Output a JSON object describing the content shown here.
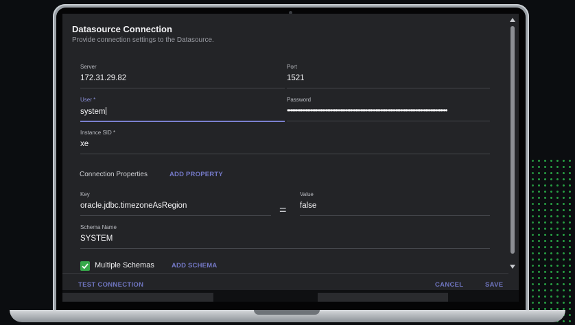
{
  "dialog": {
    "title": "Datasource Connection",
    "subtitle": "Provide connection settings to the Datasource."
  },
  "fields": {
    "server": {
      "label": "Server",
      "value": "172.31.29.82"
    },
    "port": {
      "label": "Port",
      "value": "1521"
    },
    "user": {
      "label": "User *",
      "value": "system"
    },
    "password": {
      "label": "Password",
      "value": "••••••••••••••••••••••••••••••••••••••••••••••••••••••••••••••••••••••••••••••••••••••••••••••••"
    },
    "instance_sid": {
      "label": "Instance SID *",
      "value": "xe"
    }
  },
  "connection_properties": {
    "label": "Connection Properties",
    "add_button": "ADD PROPERTY",
    "key": {
      "label": "Key",
      "value": "oracle.jdbc.timezoneAsRegion"
    },
    "value": {
      "label": "Value",
      "value": "false"
    }
  },
  "schema": {
    "label": "Schema Name",
    "value": "SYSTEM",
    "multiple_schemas_label": "Multiple Schemas",
    "multiple_schemas_checked": true,
    "add_button": "ADD SCHEMA"
  },
  "footer": {
    "test_connection": "TEST CONNECTION",
    "cancel": "CANCEL",
    "save": "SAVE"
  },
  "colors": {
    "accent": "#7b80cf",
    "checkbox": "#37a84a",
    "dialog_bg": "#232427"
  },
  "icons": [
    "check-icon",
    "scroll-up-arrow-icon",
    "scroll-down-arrow-icon"
  ]
}
